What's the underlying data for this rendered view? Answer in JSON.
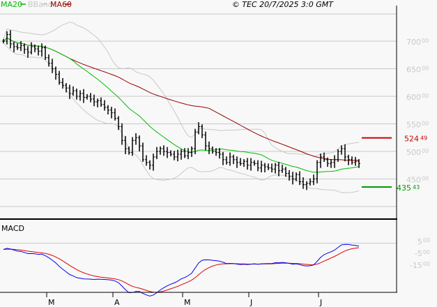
{
  "legend": [
    {
      "label": "MA20",
      "color": "#00bb00"
    },
    {
      "label": "BBands",
      "color": "#c8c8c8"
    },
    {
      "label": "MA60",
      "color": "#990000"
    }
  ],
  "copyright": "© TEC 20/7/2025 3:0 GMT",
  "markers": {
    "upper": {
      "value": "524",
      "decimals": "49",
      "color": "#cc0000",
      "price": 524.49
    },
    "lower": {
      "value": "435",
      "decimals": "43",
      "color": "#009900",
      "price": 435.43
    }
  },
  "macd_label": "MACD",
  "chart_data": {
    "type": "ohlc",
    "price_axis": {
      "ticks": [
        {
          "int": "700",
          "dec": "00",
          "v": 700
        },
        {
          "int": "650",
          "dec": "00",
          "v": 650
        },
        {
          "int": "600",
          "dec": "00",
          "v": 600
        },
        {
          "int": "550",
          "dec": "00",
          "v": 550
        },
        {
          "int": "500",
          "dec": "00",
          "v": 500
        },
        {
          "int": "450",
          "dec": "00",
          "v": 450
        }
      ],
      "range": [
        400,
        725
      ]
    },
    "macd_axis": {
      "ticks": [
        {
          "int": "5",
          "dec": "00",
          "v": 500
        },
        {
          "int": "-5",
          "dec": "00",
          "v": -500
        },
        {
          "int": "-15",
          "dec": "00",
          "v": -1500
        }
      ]
    },
    "month_labels": [
      {
        "label": "M",
        "index": 12
      },
      {
        "label": "A",
        "index": 31
      },
      {
        "label": "M",
        "index": 51
      },
      {
        "label": "J",
        "index": 70
      },
      {
        "label": "J",
        "index": 90
      }
    ],
    "closes": [
      700,
      712,
      695,
      690,
      688,
      692,
      685,
      680,
      690,
      686,
      682,
      688,
      670,
      660,
      650,
      640,
      625,
      620,
      615,
      605,
      610,
      600,
      605,
      598,
      600,
      595,
      590,
      592,
      585,
      580,
      575,
      570,
      560,
      545,
      520,
      505,
      498,
      520,
      525,
      510,
      485,
      480,
      475,
      490,
      500,
      505,
      500,
      498,
      495,
      490,
      495,
      500,
      492,
      498,
      505,
      535,
      545,
      530,
      510,
      505,
      500,
      498,
      495,
      485,
      480,
      490,
      485,
      480,
      478,
      482,
      475,
      480,
      478,
      470,
      475,
      472,
      470,
      468,
      475,
      465,
      468,
      460,
      455,
      450,
      458,
      445,
      440,
      442,
      445,
      450,
      480,
      490,
      485,
      478,
      480,
      485,
      500,
      505,
      490,
      485,
      480,
      482,
      478
    ],
    "series": [
      "MA20",
      "MA60",
      "BBands upper",
      "BBands lower",
      "MACD",
      "Signal"
    ]
  }
}
